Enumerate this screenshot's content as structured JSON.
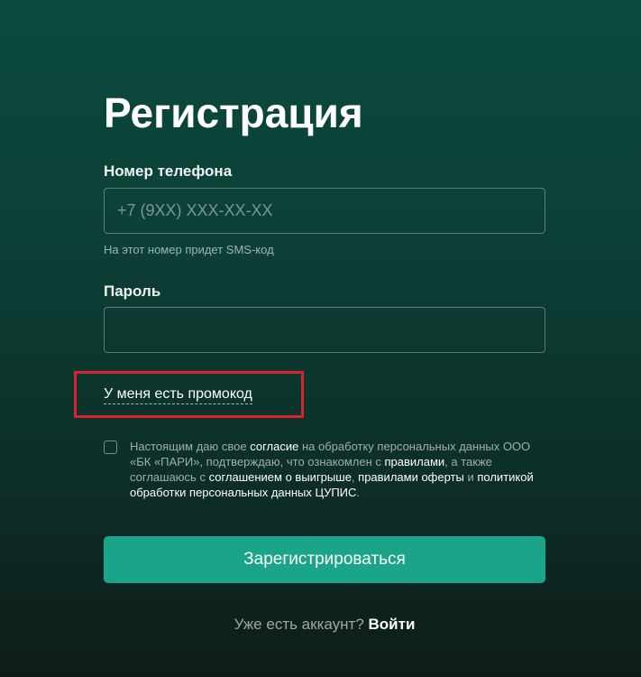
{
  "form": {
    "title": "Регистрация",
    "phone_label": "Номер телефона",
    "phone_placeholder": "+7 (9XX) XXX-XX-XX",
    "phone_hint": "На этот номер придет SMS-код",
    "password_label": "Пароль",
    "password_value": "",
    "promo_link": "У меня есть промокод",
    "consent": {
      "t1": "Настоящим даю свое ",
      "l1": "согласие",
      "t2": " на обработку персональных данных ООО «БК «ПАРИ», подтверждаю, что ознакомлен с ",
      "l2": "правилами",
      "t3": ", а также соглашаюсь с ",
      "l3": "соглашением о выигрыше",
      "t4": ", ",
      "l4": "правилами оферты",
      "t5": " и ",
      "l5": "политикой обработки персональных данных ЦУПИС",
      "t6": "."
    },
    "submit_label": "Зарегистрироваться",
    "footer_text": "Уже есть аккаунт? ",
    "login_label": "Войти"
  },
  "colors": {
    "accent": "#1aa58a",
    "highlight": "#d8242a",
    "background_top": "#0a4a3f",
    "background_bottom": "#0e1c19"
  }
}
